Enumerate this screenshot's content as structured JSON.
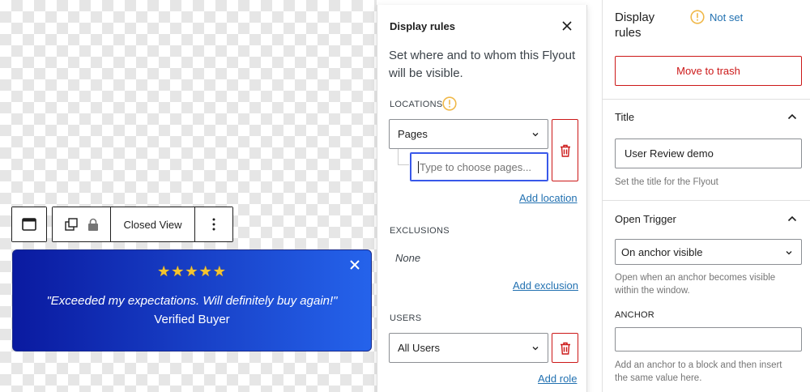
{
  "colors": {
    "accent": "#2271b1",
    "danger": "#cc1818",
    "warning": "#f0b849",
    "flyout_start": "#0a1aa0",
    "flyout_end": "#2563eb"
  },
  "toolbar": {
    "block_icon": "window-block-icon",
    "copy_icon": "duplicate-icon",
    "lock_icon": "lock-icon",
    "view_label": "Closed View",
    "more_icon": "more-vertical-icon"
  },
  "flyout": {
    "stars": "★★★★★",
    "quote": "\"Exceeded my expectations. Will definitely buy again!\"",
    "author": "Verified Buyer"
  },
  "popover": {
    "title": "Display rules",
    "description": "Set where and to whom this Flyout will be visible.",
    "locations": {
      "label": "LOCATIONS",
      "select_value": "Pages",
      "input_placeholder": "Type to choose pages...",
      "add_link": "Add location"
    },
    "exclusions": {
      "label": "EXCLUSIONS",
      "none_text": "None",
      "add_link": "Add exclusion"
    },
    "users": {
      "label": "USERS",
      "select_value": "All Users",
      "add_link": "Add role"
    }
  },
  "sidebar": {
    "title": "Display rules",
    "status": "Not set",
    "trash_label": "Move to trash",
    "title_panel": {
      "heading": "Title",
      "value": "User Review demo",
      "help": "Set the title for the Flyout"
    },
    "trigger_panel": {
      "heading": "Open Trigger",
      "select_value": "On anchor visible",
      "help": "Open when an anchor becomes visible within the window.",
      "anchor_label": "ANCHOR",
      "anchor_value": "",
      "anchor_help": "Add an anchor to a block and then insert the same value here."
    }
  }
}
